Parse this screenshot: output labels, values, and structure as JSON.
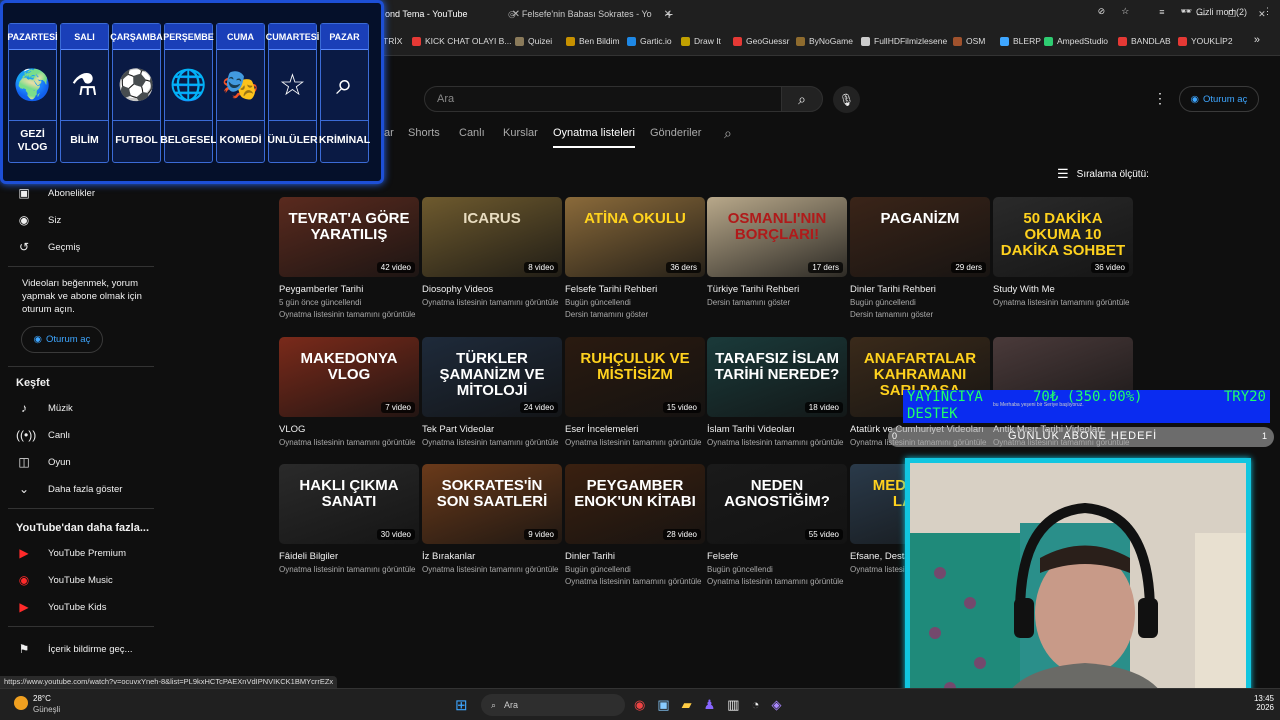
{
  "browser": {
    "tabs": [
      {
        "title": "ond Tema - YouTube"
      },
      {
        "title": "Felsefe'nin Babası Sokrates - Yo"
      }
    ],
    "new_tab": "+",
    "window_controls": [
      "—",
      "❐",
      "✕"
    ],
    "incognito_label": "Gizli mod (2)",
    "bookmarks": [
      "TRİX",
      "KICK CHAT OLAYI B...",
      "Quizei",
      "Ben Bildim",
      "Gartic.io",
      "Draw It",
      "GeoGuessr",
      "ByNoGame",
      "FullHDFilmizlesene",
      "OSM",
      "BLERP",
      "AmpedStudio",
      "BANDLAB",
      "YOUKLİP2"
    ],
    "bookmark_colors": [
      "#c53b3b",
      "#e53935",
      "#8a7a5a",
      "#c79100",
      "#1e88e5",
      "#c0a000",
      "#e53935",
      "#8e6b2e",
      "#cccccc",
      "#a0522d",
      "#3ea6ff",
      "#2ecc71",
      "#e53935",
      "#e53935"
    ],
    "status_url": "https://www.youtube.com/watch?v=ocuvxYneh-8&list=PL9kxHCTcPAEXnVdIPNVIKCK1BMYcrrEZx"
  },
  "schedule": {
    "days": [
      {
        "day": "PAZARTESİ",
        "label": "GEZİ VLOG",
        "icon": "🌍"
      },
      {
        "day": "SALI",
        "label": "BİLİM",
        "icon": "⚗"
      },
      {
        "day": "ÇARŞAMBA",
        "label": "FUTBOL",
        "icon": "⚽"
      },
      {
        "day": "PERŞEMBE",
        "label": "BELGESEL",
        "icon": "🌐"
      },
      {
        "day": "CUMA",
        "label": "KOMEDİ",
        "icon": "🎭"
      },
      {
        "day": "CUMARTESİ",
        "label": "ÜNLÜLER",
        "icon": "☆"
      },
      {
        "day": "PAZAR",
        "label": "KRİMİNAL",
        "icon": "⌕"
      }
    ]
  },
  "youtube": {
    "search_placeholder": "Ara",
    "sign_in": "Oturum aç",
    "channel_tabs": [
      "ar",
      "Shorts",
      "Canlı",
      "Kurslar",
      "Oynatma listeleri",
      "Gönderiler"
    ],
    "active_tab": "Oynatma listeleri",
    "sort_label": "Sıralama ölçütü:",
    "sidebar": {
      "top_items": [
        "Abonelikler",
        "Siz",
        "Geçmiş"
      ],
      "signin_message": "Videoları beğenmek, yorum yapmak ve abone olmak için oturum açın.",
      "signin_button": "Oturum aç",
      "explore_heading": "Keşfet",
      "explore_items": [
        "Müzik",
        "Canlı",
        "Oyun",
        "Daha fazla göster"
      ],
      "more_heading": "YouTube'dan daha fazla...",
      "more_items": [
        "YouTube Premium",
        "YouTube Music",
        "YouTube Kids"
      ],
      "report_item": "İçerik bildirme geç..."
    },
    "playlists": [
      {
        "title": "Peygamberler Tarihi",
        "count": "42 video",
        "sub": "5 gün önce güncellendi",
        "link": "Oynatma listesinin tamamını görüntüle",
        "thumb_text": "Tevrat'a Göre Yaratılış",
        "bg": "#5a2a1e",
        "fg": "#ffffff"
      },
      {
        "title": "Diosophy Videos",
        "count": "8 video",
        "sub": "Oynatma listesinin tamamını görüntüle",
        "link": "",
        "thumb_text": "ICARUS",
        "bg": "#6e5a2e",
        "fg": "#e8dcc0"
      },
      {
        "title": "Felsefe Tarihi Rehberi",
        "count": "36 ders",
        "sub": "Bugün güncellendi",
        "link": "Dersin tamamını göster",
        "thumb_text": "ATİNA OKULU",
        "bg": "#8a6a3a",
        "fg": "#ffd21e"
      },
      {
        "title": "Türkiye Tarihi Rehberi",
        "count": "17 ders",
        "sub": "Dersin tamamını göster",
        "link": "",
        "thumb_text": "OSMANLI'NIN BORÇLARI!",
        "bg": "#b8a88a",
        "fg": "#b01a1a"
      },
      {
        "title": "Dinler Tarihi Rehberi",
        "count": "29 ders",
        "sub": "Bugün güncellendi",
        "link": "Dersin tamamını göster",
        "thumb_text": "PAGANİZM",
        "bg": "#3a2418",
        "fg": "#ffffff"
      },
      {
        "title": "Study With Me",
        "count": "36 video",
        "sub": "Oynatma listesinin tamamını görüntüle",
        "link": "",
        "thumb_text": "50 DAKİKA OKUMA 10 DAKİKA SOHBET",
        "bg": "#2a2a2a",
        "fg": "#ffd21e"
      },
      {
        "title": "VLOG",
        "count": "7 video",
        "sub": "Oynatma listesinin tamamını görüntüle",
        "link": "",
        "thumb_text": "MAKEDONYA VLOG",
        "bg": "#7a2a1a",
        "fg": "#ffffff"
      },
      {
        "title": "Tek Part Videolar",
        "count": "24 video",
        "sub": "Oynatma listesinin tamamını görüntüle",
        "link": "",
        "thumb_text": "TÜRKLER ŞAMANİZM VE MİTOLOJİ",
        "bg": "#1e2a3a",
        "fg": "#ffffff"
      },
      {
        "title": "Eser İncelemeleri",
        "count": "15 video",
        "sub": "Oynatma listesinin tamamını görüntüle",
        "link": "",
        "thumb_text": "RUHÇULUK VE MİSTİSİZM",
        "bg": "#2a1a10",
        "fg": "#ffd21e"
      },
      {
        "title": "İslam Tarihi Videoları",
        "count": "18 video",
        "sub": "Oynatma listesinin tamamını görüntüle",
        "link": "",
        "thumb_text": "TARAFSIZ İSLAM TARİHİ NEREDE?",
        "bg": "#1a3a3a",
        "fg": "#ffffff"
      },
      {
        "title": "Atatürk ve Cumhuriyet Videoları",
        "count": "",
        "sub": "Oynatma listesinin tamamını görüntüle",
        "link": "",
        "thumb_text": "ANAFARTALAR KAHRAMANI SARI PAŞA",
        "bg": "#3a2a1a",
        "fg": "#ffd21e"
      },
      {
        "title": "Antik Mısır Tarihi Videoları",
        "count": "",
        "sub": "Oynatma listesinin tamamını görüntüle",
        "link": "",
        "thumb_text": "",
        "bg": "#4a3a3a",
        "fg": "#ffffff"
      },
      {
        "title": "Fâideli Bilgiler",
        "count": "30 video",
        "sub": "Oynatma listesinin tamamını görüntüle",
        "link": "",
        "thumb_text": "HAKLI ÇIKMA SANATI",
        "bg": "#2a2a2a",
        "fg": "#ffffff"
      },
      {
        "title": "İz Bırakanlar",
        "count": "9 video",
        "sub": "Oynatma listesinin tamamını görüntüle",
        "link": "",
        "thumb_text": "SOKRATES'İN SON SAATLERİ",
        "bg": "#6a3a1a",
        "fg": "#ffffff"
      },
      {
        "title": "Dinler Tarihi",
        "count": "28 video",
        "sub": "Bugün güncellendi",
        "link": "Oynatma listesinin tamamını görüntüle",
        "thumb_text": "PEYGAMBER ENOK'UN KİTABI",
        "bg": "#3a2010",
        "fg": "#ffffff"
      },
      {
        "title": "Felsefe",
        "count": "55 video",
        "sub": "Bugün güncellendi",
        "link": "Oynatma listesinin tamamını görüntüle",
        "thumb_text": "NEDEN AGNOSTİĞİM?",
        "bg": "#1a1a1a",
        "fg": "#ffffff"
      },
      {
        "title": "Efsane, Desta",
        "count": "",
        "sub": "Oynatma listesinin",
        "link": "",
        "thumb_text": "MEDUSA'NIN LANETİ",
        "bg": "#2a3a4a",
        "fg": "#ffd21e"
      }
    ]
  },
  "stream_overlay": {
    "donation_text": "YAYINCIYA DESTEK",
    "donation_amount": "70₺ (350.00%)",
    "donation_target": "TRY20",
    "mini_caption": "bu Merhaba yeşeni bir Seriye başlıyoruz.",
    "goal_label": "GÜNLÜK ABONE HEDEFİ",
    "goal_left": "0",
    "goal_right": "1"
  },
  "taskbar": {
    "weather_temp": "28°C",
    "weather_desc": "Güneşli",
    "search_label": "Ara",
    "clock_time": "13:45",
    "clock_date": "2026"
  }
}
